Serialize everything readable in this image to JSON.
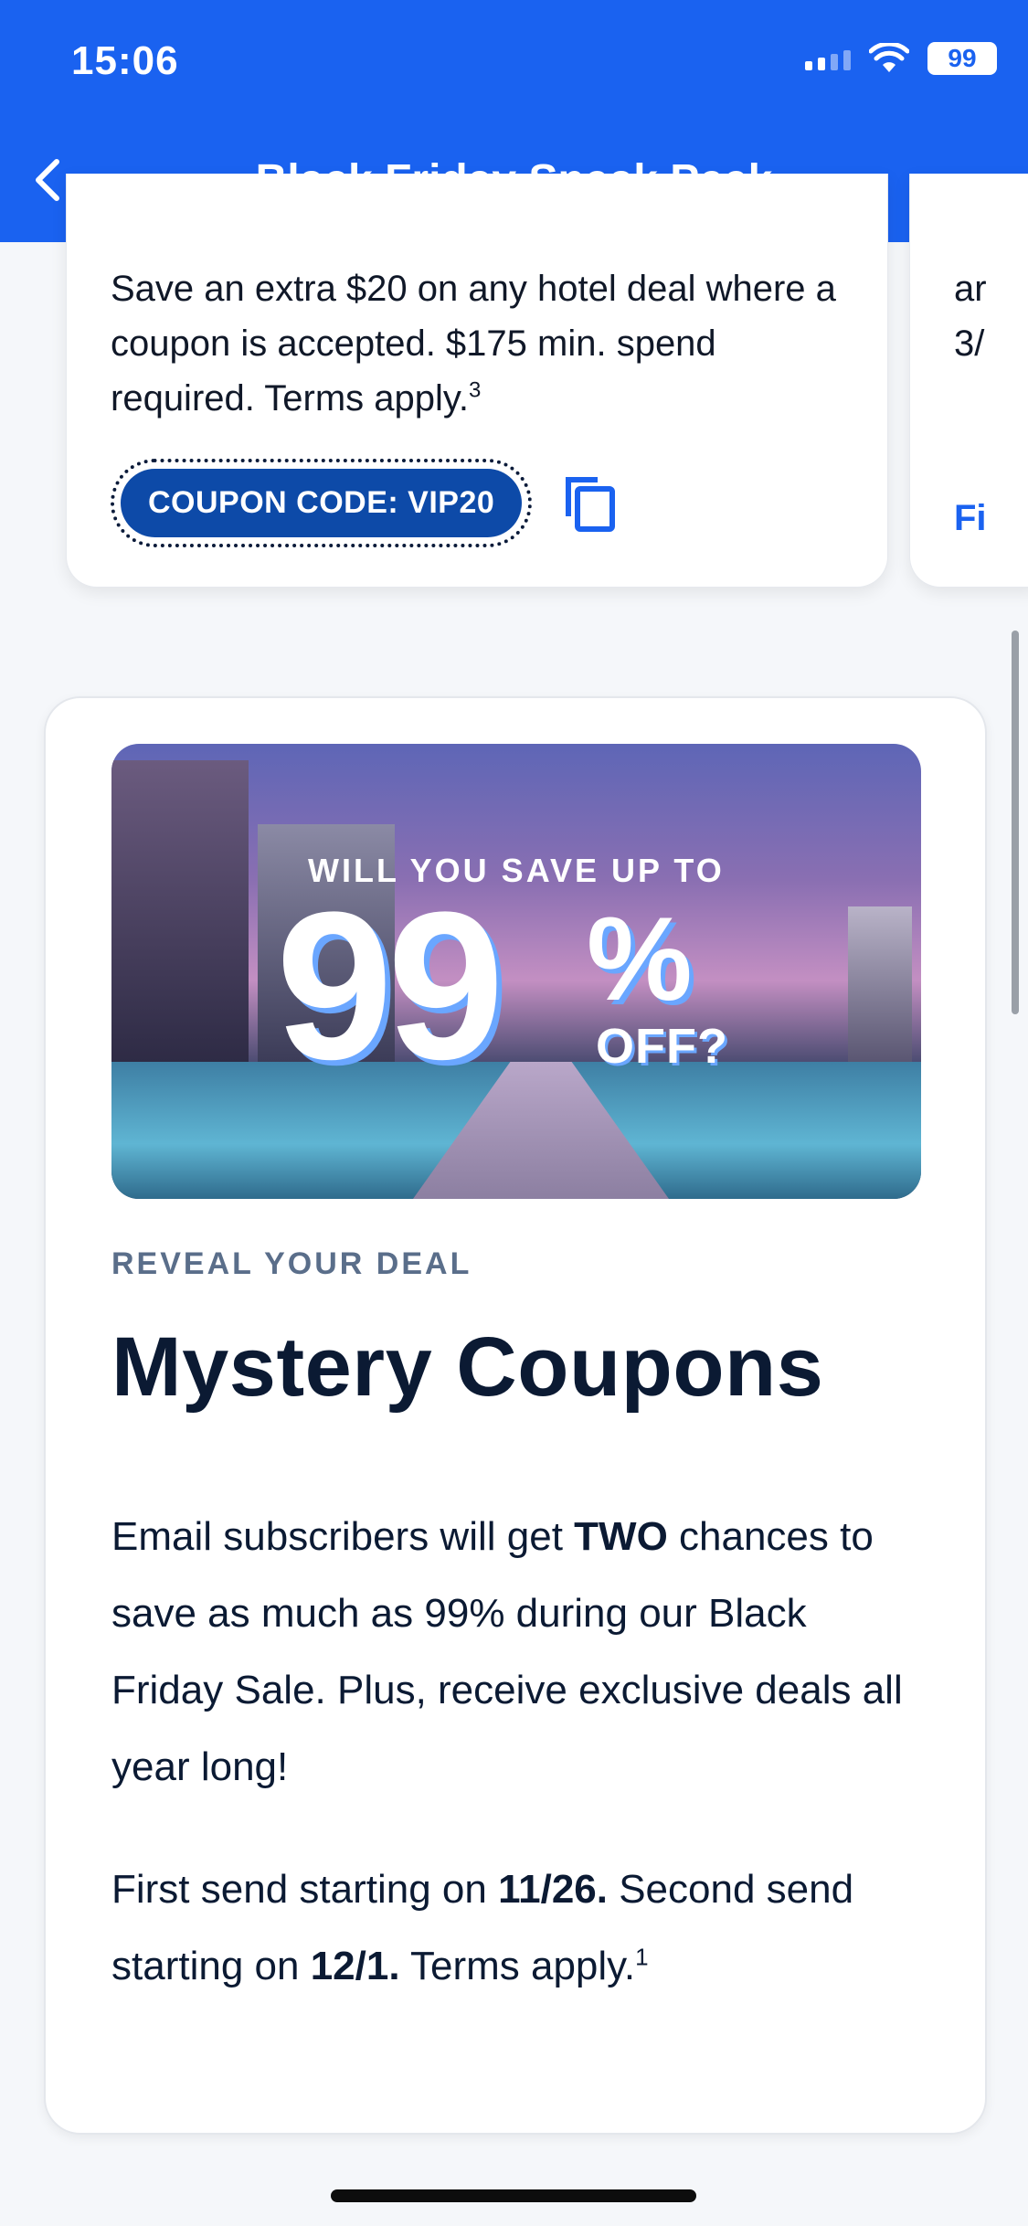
{
  "status_bar": {
    "time": "15:06",
    "battery": "99"
  },
  "nav": {
    "title": "Black Friday Sneak Peek"
  },
  "coupon_card": {
    "text_1": "Save an extra $20 on any hotel deal where a coupon is accepted. $175 min. spend required. Terms apply.",
    "footnote": "3",
    "code_label": "COUPON CODE: VIP20"
  },
  "side_card": {
    "text": "ar 3/",
    "link": "Fi"
  },
  "promo": {
    "hero_kicker": "WILL YOU SAVE UP TO",
    "hero_number": "99",
    "hero_percent": "%",
    "hero_off": "OFF?",
    "eyebrow": "REVEAL YOUR DEAL",
    "title": "Mystery Coupons",
    "para1_a": "Email subscribers will get ",
    "para1_bold": "TWO",
    "para1_b": " chances to save as much as 99% during our Black Friday Sale. Plus, receive exclusive deals all year long!",
    "para2_a": "First send starting on ",
    "para2_date1": "11/26.",
    "para2_b": " Second send starting on ",
    "para2_date2": "12/1.",
    "para2_c": " Terms apply.",
    "para2_footnote": "1"
  },
  "colors": {
    "brand_blue": "#1a62f0",
    "coupon_pill": "#0d4aa8",
    "title_navy": "#0b1a33",
    "eyebrow_gray": "#5a6e8a"
  },
  "icons": [
    "back-chevron-icon",
    "signal-icon",
    "wifi-icon",
    "battery-icon",
    "copy-icon"
  ]
}
